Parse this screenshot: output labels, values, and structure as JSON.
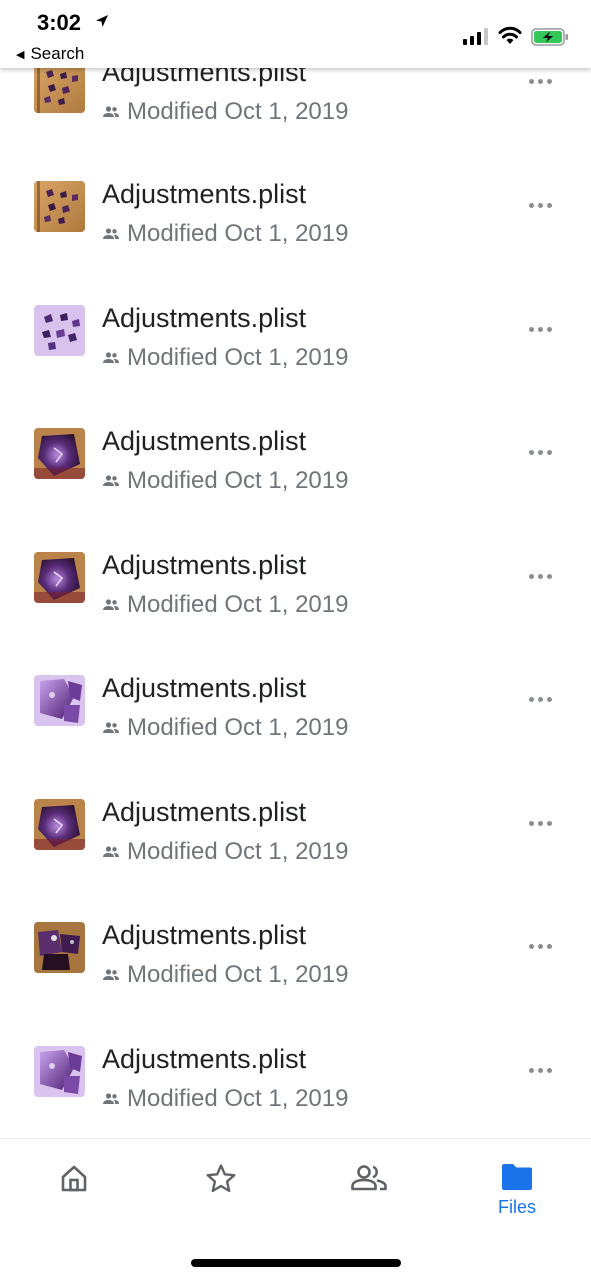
{
  "status_bar": {
    "time": "3:02",
    "back_label": "Search"
  },
  "files": [
    {
      "name": "Adjustments.plist",
      "modified": "Modified Oct 1, 2019",
      "thumb": "wood"
    },
    {
      "name": "Adjustments.plist",
      "modified": "Modified Oct 1, 2019",
      "thumb": "wood"
    },
    {
      "name": "Adjustments.plist",
      "modified": "Modified Oct 1, 2019",
      "thumb": "lavender"
    },
    {
      "name": "Adjustments.plist",
      "modified": "Modified Oct 1, 2019",
      "thumb": "glow"
    },
    {
      "name": "Adjustments.plist",
      "modified": "Modified Oct 1, 2019",
      "thumb": "glow"
    },
    {
      "name": "Adjustments.plist",
      "modified": "Modified Oct 1, 2019",
      "thumb": "purple"
    },
    {
      "name": "Adjustments.plist",
      "modified": "Modified Oct 1, 2019",
      "thumb": "glow"
    },
    {
      "name": "Adjustments.plist",
      "modified": "Modified Oct 1, 2019",
      "thumb": "dark"
    },
    {
      "name": "Adjustments.plist",
      "modified": "Modified Oct 1, 2019",
      "thumb": "purple"
    }
  ],
  "tab_bar": {
    "tabs": [
      {
        "id": "home",
        "icon": "home-icon",
        "label": ""
      },
      {
        "id": "starred",
        "icon": "star-icon",
        "label": ""
      },
      {
        "id": "shared",
        "icon": "people-icon",
        "label": ""
      },
      {
        "id": "files",
        "icon": "folder-icon",
        "label": "Files",
        "active": true
      }
    ]
  },
  "colors": {
    "accent": "#1a73e8",
    "secondary_text": "#70757a",
    "primary_text": "#202124"
  }
}
